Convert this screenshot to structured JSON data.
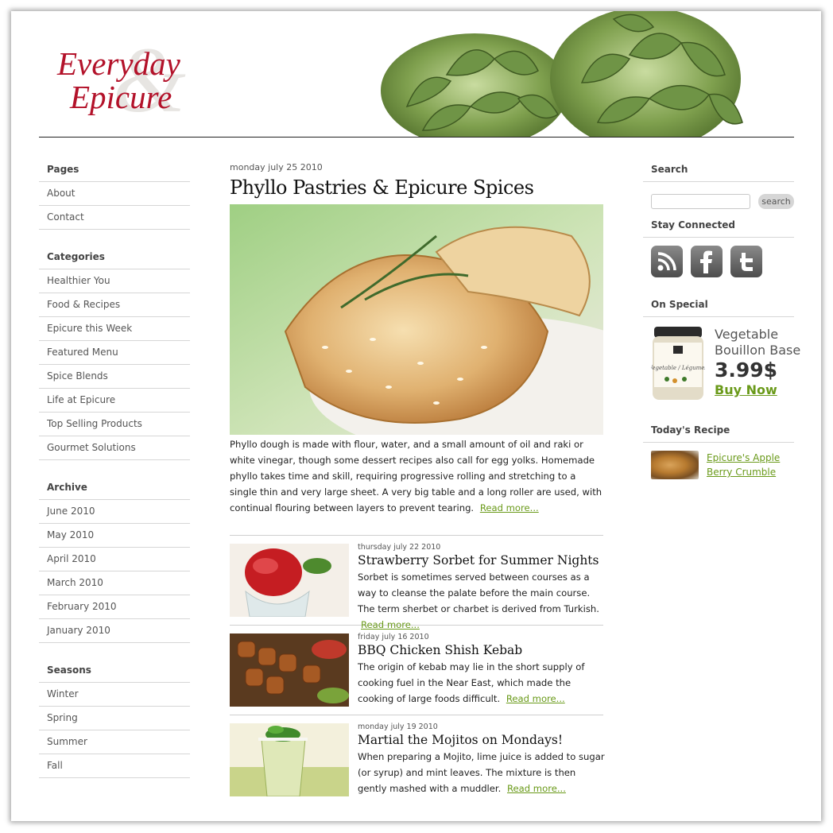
{
  "header": {
    "logo_line1": "Everyday",
    "logo_line2": "Epicure",
    "logo_ampersand": "&"
  },
  "left_sidebar": {
    "pages": {
      "title": "Pages",
      "items": [
        "About",
        "Contact"
      ]
    },
    "categories": {
      "title": "Categories",
      "items": [
        "Healthier You",
        "Food & Recipes",
        "Epicure this Week",
        "Featured Menu",
        "Spice Blends",
        "Life at Epicure",
        "Top Selling Products",
        "Gourmet Solutions"
      ]
    },
    "archive": {
      "title": "Archive",
      "items": [
        "June 2010",
        "May 2010",
        "April 2010",
        "March 2010",
        "February 2010",
        "January 2010"
      ]
    },
    "seasons": {
      "title": "Seasons",
      "items": [
        "Winter",
        "Spring",
        "Summer",
        "Fall"
      ]
    }
  },
  "featured": {
    "date": "monday july 25 2010",
    "title": "Phyllo Pastries & Epicure Spices",
    "excerpt": "Phyllo dough is made with flour, water, and a small amount of oil and raki or white vinegar, though some dessert recipes also call for egg yolks. Homemade phyllo takes time and skill, requiring progressive rolling and stretching to a single thin and very large sheet. A very big table and a long roller are used, with continual flouring between layers to prevent tearing.",
    "read_more": "Read more..."
  },
  "posts": [
    {
      "date": "thursday july 22 2010",
      "title": "Strawberry Sorbet for Summer Nights",
      "text": "Sorbet is sometimes served between courses as a way to cleanse the palate before the main course. The term sherbet or charbet is derived from Turkish.",
      "read_more": "Read more..."
    },
    {
      "date": "friday july 16 2010",
      "title": "BBQ Chicken Shish Kebab",
      "text": "The origin of kebab may lie in the short supply of cooking fuel in the Near East, which made the cooking of large foods difficult.",
      "read_more": "Read more..."
    },
    {
      "date": "monday july 19 2010",
      "title": "Martial the Mojitos on Mondays!",
      "text": "When preparing a Mojito, lime juice is added to sugar (or syrup) and mint leaves. The mixture is then gently mashed with a muddler.",
      "read_more": "Read more..."
    }
  ],
  "right_sidebar": {
    "search": {
      "title": "Search",
      "placeholder": "",
      "button": "search"
    },
    "connected": {
      "title": "Stay Connected",
      "icons": [
        "rss-icon",
        "facebook-icon",
        "twitter-icon"
      ]
    },
    "special": {
      "title": "On Special",
      "product": "Vegetable Bouillon Base",
      "price": "3.99$",
      "buy": "Buy Now",
      "jar_label": "Vegetable / Légumes"
    },
    "recipe": {
      "title": "Today's Recipe",
      "link": "Epicure's Apple Berry Crumble"
    }
  },
  "colors": {
    "brand_red": "#b3122a",
    "link_green": "#6a9a1a"
  }
}
